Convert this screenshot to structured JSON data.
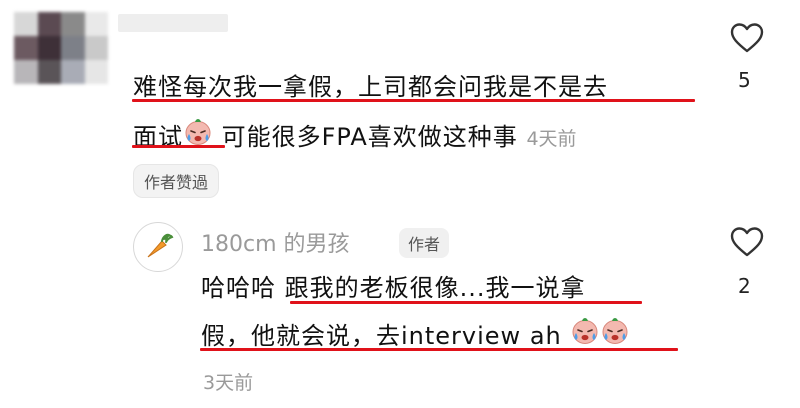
{
  "comment": {
    "line1": "难怪每次我一拿假，上司都会问我是不是去",
    "line2_a": "面试",
    "line2_b": " 可能很多FPA喜欢做这种事",
    "time": "4天前",
    "like_count": "5",
    "author_liked": "作者赞過"
  },
  "reply": {
    "username": "180cm 的男孩",
    "author_badge": "作者",
    "line1_a": "哈哈哈 ",
    "line1_b": "跟我的老板很像...我一说拿",
    "line2": "假，他就会说，去interview ah",
    "time": "3天前",
    "like_count": "2"
  },
  "icons": {
    "heart": "heart-outline-icon",
    "emoji": "crying-face-emoji",
    "avatar": "carrot-icon"
  },
  "colors": {
    "underline": "#e0121a",
    "meta": "#9a9a9a"
  }
}
